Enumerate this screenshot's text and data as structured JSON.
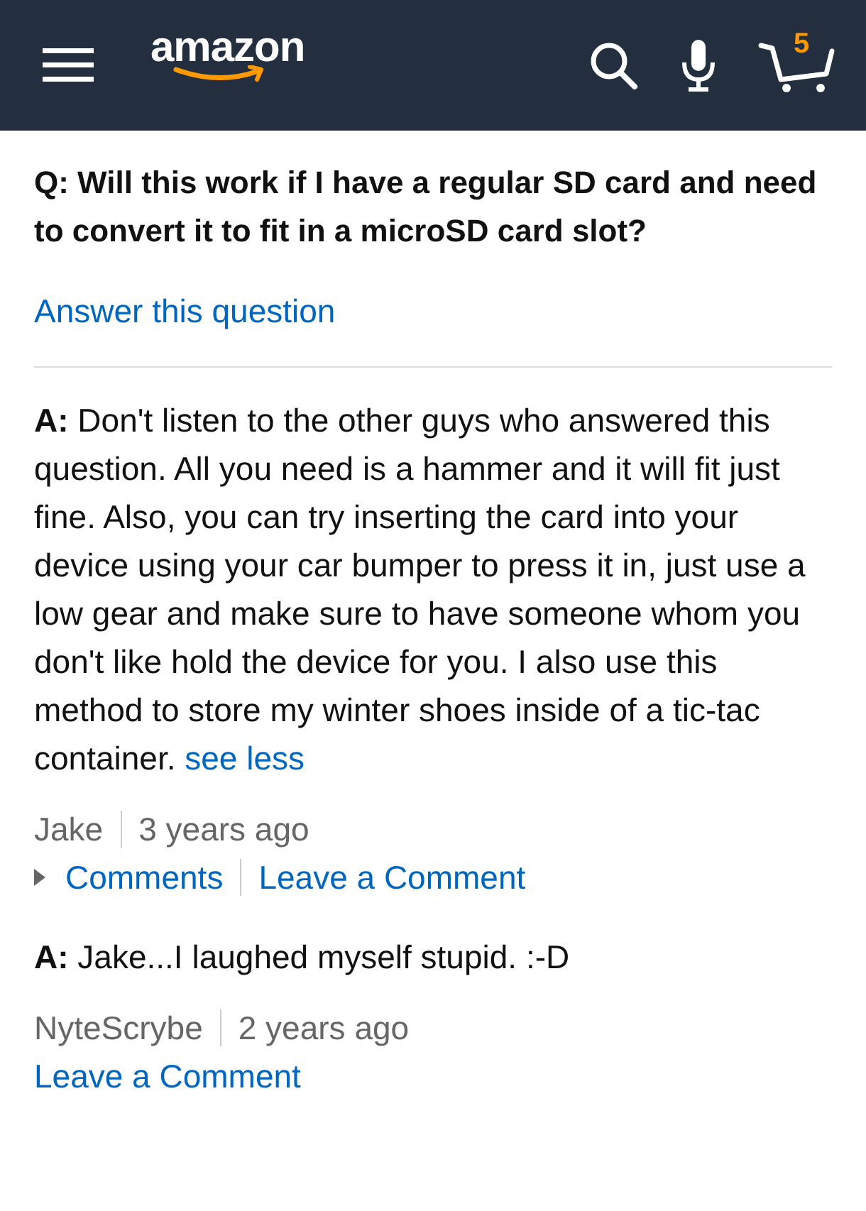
{
  "header": {
    "logo": "amazon",
    "cart_count": "5"
  },
  "question": {
    "text": "Q: Will this work if I have a regular SD card and need to convert it to fit in a microSD card slot?",
    "answer_link": "Answer this question"
  },
  "answers": [
    {
      "text": "**A:** Don't listen to the other guys who answered this question. All you need is a hammer and it will fit just fine. Also, you can try inserting the card into your device using your car bumper to press it in, just use a low gear and make sure to have someone whom you don't like hold the device for you. I also use this method to store my winter shoes inside of a tic-tac container.",
      "toggle": "see less",
      "author": "Jake",
      "time": "3 years ago",
      "comments_link": "Comments",
      "leave_comment": "Leave a Comment"
    },
    {
      "text": "**A:** Jake...I laughed myself stupid. :-D",
      "author": "NyteScrybe",
      "time": "2 years ago",
      "leave_comment": "Leave a Comment"
    }
  ]
}
